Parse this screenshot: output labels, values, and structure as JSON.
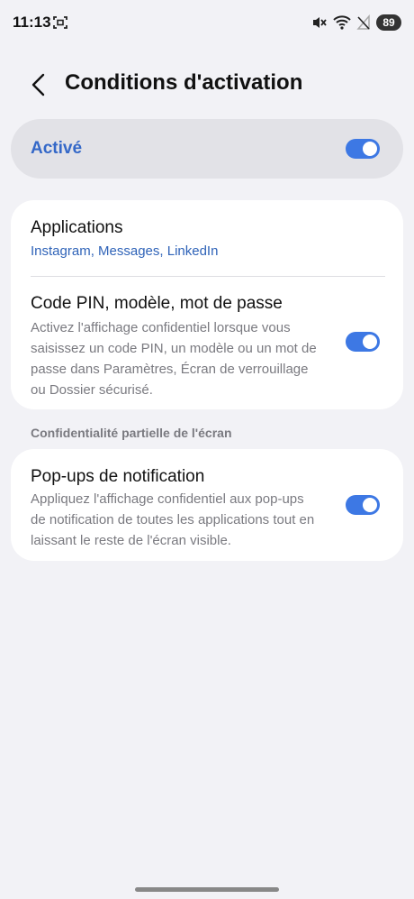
{
  "status_bar": {
    "time": "11:13",
    "battery": "89"
  },
  "header": {
    "title": "Conditions d'activation"
  },
  "master_switch": {
    "label": "Activé",
    "state": "on"
  },
  "settings": {
    "applications": {
      "title": "Applications",
      "value": "Instagram, Messages, LinkedIn"
    },
    "pin": {
      "title": "Code PIN, modèle, mot de passe",
      "description": "Activez l'affichage confidentiel lorsque vous saisissez un code PIN, un modèle ou un mot de passe dans Paramètres, Écran de verrouillage ou Dossier sécurisé.",
      "state": "on"
    }
  },
  "partial_section": {
    "header": "Confidentialité partielle de l'écran",
    "popups": {
      "title": "Pop-ups de notification",
      "description": "Appliquez l'affichage confidentiel aux pop-ups de notification de toutes les applications tout en laissant le reste de l'écran visible.",
      "state": "on"
    }
  },
  "colors": {
    "accent": "#3d78e4",
    "accent_text": "#3468c8",
    "background": "#f2f2f6"
  }
}
